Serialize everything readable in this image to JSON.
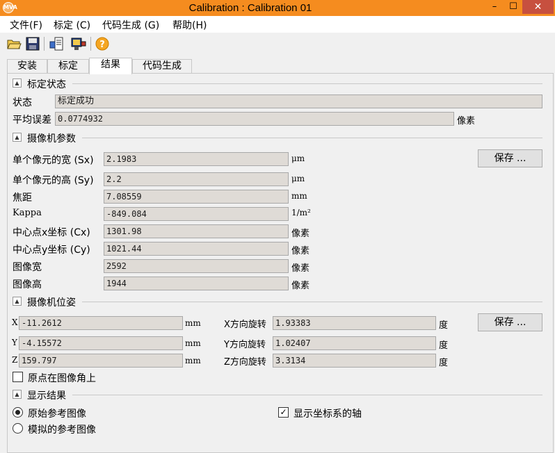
{
  "window": {
    "title": "Calibration : Calibration 01",
    "app_icon": "MVA",
    "minimize": "–",
    "maximize": "☐",
    "close": "✕"
  },
  "menu": [
    "文件(F)",
    "标定 (C)",
    "代码生成 (G)",
    "帮助(H)"
  ],
  "toolbar": {
    "icons": [
      "open-folder-icon",
      "save-icon",
      "export-icon",
      "camera-settings-icon",
      "help-icon"
    ]
  },
  "tabs": [
    "安装",
    "标定",
    "结果",
    "代码生成"
  ],
  "active_tab": "结果",
  "calib_status": {
    "title": "标定状态",
    "status_label": "状态",
    "status_value": "标定成功",
    "mean_error_label": "平均误差",
    "mean_error_value": "0.0774932",
    "mean_error_unit": "像素"
  },
  "camera_params": {
    "title": "摄像机参数",
    "save_label": "保存 ...",
    "rows": [
      {
        "label": "单个像元的宽 (Sx)",
        "value": "2.1983",
        "unit": "μm"
      },
      {
        "label": "单个像元的高 (Sy)",
        "value": "2.2",
        "unit": "μm"
      },
      {
        "label": "焦距",
        "value": "7.08559",
        "unit": "mm"
      },
      {
        "label": "Kappa",
        "value": "-849.084",
        "unit": "1/m²"
      },
      {
        "label": "中心点x坐标 (Cx)",
        "value": "1301.98",
        "unit": "像素"
      },
      {
        "label": "中心点y坐标 (Cy)",
        "value": "1021.44",
        "unit": "像素"
      },
      {
        "label": "图像宽",
        "value": "2592",
        "unit": "像素"
      },
      {
        "label": "图像高",
        "value": "1944",
        "unit": "像素"
      }
    ]
  },
  "camera_pose": {
    "title": "摄像机位姿",
    "save_label": "保存 ...",
    "translation": [
      {
        "label": "X",
        "value": "-11.2612",
        "unit": "mm"
      },
      {
        "label": "Y",
        "value": "-4.15572",
        "unit": "mm"
      },
      {
        "label": "Z",
        "value": "159.797",
        "unit": "mm"
      }
    ],
    "rotation": [
      {
        "label": "X方向旋转",
        "value": "1.93383",
        "unit": "度"
      },
      {
        "label": "Y方向旋转",
        "value": "1.02407",
        "unit": "度"
      },
      {
        "label": "Z方向旋转",
        "value": "3.3134",
        "unit": "度"
      }
    ],
    "origin_checkbox_label": "原点在图像角上",
    "origin_checked": false
  },
  "display": {
    "title": "显示结果",
    "radio_original": "原始参考图像",
    "radio_simulated": "模拟的参考图像",
    "selected": "原始参考图像",
    "show_axes_label": "显示坐标系的轴",
    "show_axes_checked": true
  }
}
